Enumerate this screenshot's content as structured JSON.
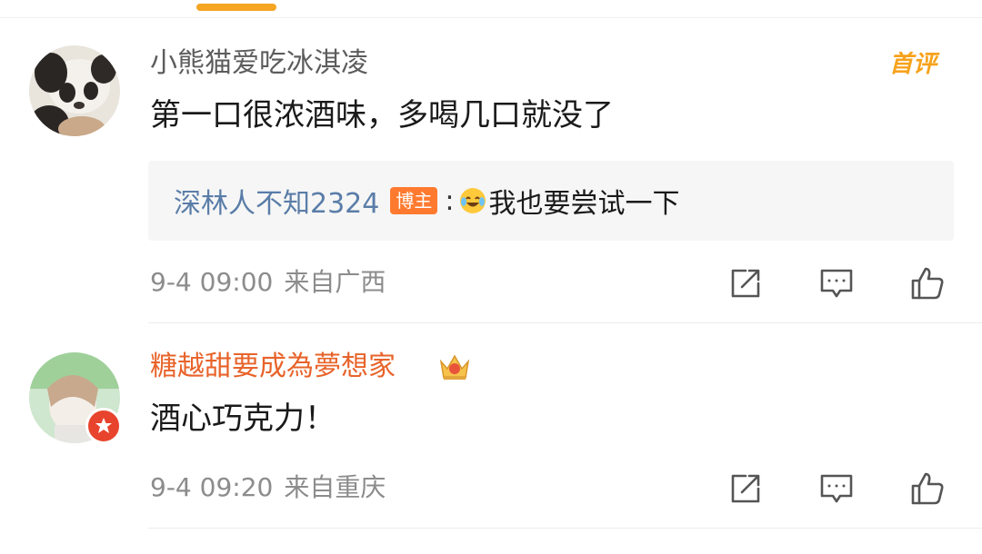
{
  "comments": [
    {
      "username": "小熊猫爱吃冰淇凌",
      "text": "第一口很浓酒味，多喝几口就没了",
      "first_badge": "首评",
      "reply": {
        "user": "深林人不知2324",
        "badge": "博主",
        "colon": ":",
        "emoji": "laughing-tears-emoji",
        "text": "我也要尝试一下"
      },
      "time": "9-4 09:00",
      "location": "来自广西"
    },
    {
      "username": "糖越甜要成為夢想家",
      "username_color": "#e8632a",
      "text": "酒心巧克力！",
      "time": "9-4 09:20",
      "location": "来自重庆"
    }
  ],
  "icons": {
    "share": "share-icon",
    "comment": "comment-icon",
    "like": "thumbs-up-icon",
    "crown": "crown-icon"
  },
  "colors": {
    "accent": "#f5a623",
    "reply_user": "#5a7da8",
    "host_badge": "#ff7a2f",
    "meta": "#8c8c8c"
  }
}
